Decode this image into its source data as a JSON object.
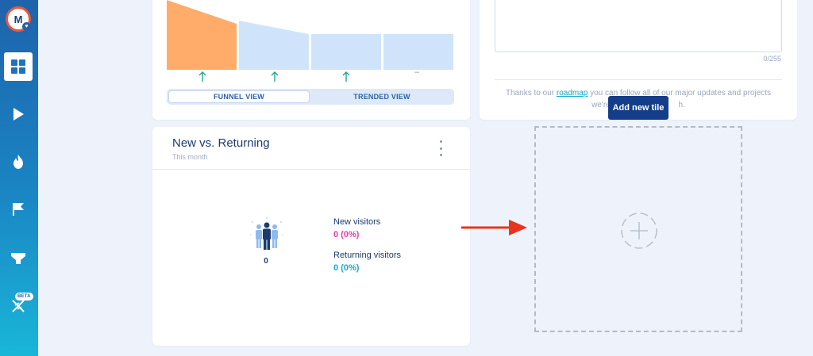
{
  "sidebar": {
    "logo_letter": "M",
    "beta_label": "BETA",
    "items": [
      {
        "icon": "dashboard-grid-icon",
        "active": true
      },
      {
        "icon": "play-icon"
      },
      {
        "icon": "flame-icon"
      },
      {
        "icon": "flag-icon"
      },
      {
        "icon": "funnel-icon"
      },
      {
        "icon": "dna-icon"
      }
    ]
  },
  "funnel": {
    "step_changes": [
      "↑",
      "↑",
      "↑",
      "–"
    ],
    "tabs": [
      {
        "label": "FUNNEL VIEW",
        "active": true
      },
      {
        "label": "TRENDED VIEW",
        "active": false
      }
    ]
  },
  "roadmap": {
    "char_count": "0/255",
    "text_before": "Thanks to our ",
    "link": "roadmap",
    "text_after": " you can follow all of our major updates and projects we're c",
    "text_tail": "h."
  },
  "add_tile": {
    "label": "Add new tile"
  },
  "new_vs_returning": {
    "title": "New vs. Returning",
    "subtitle": "This month",
    "total": "0",
    "new_label": "New visitors",
    "new_value": "0 (0%)",
    "returning_label": "Returning visitors",
    "returning_value": "0 (0%)"
  },
  "colors": {
    "accent_new": "#e23fb0",
    "accent_returning": "#15a9d4",
    "funnel_first": "#ffac6b",
    "funnel_rest": "#cfe4fb",
    "arrow": "#e8351f"
  }
}
